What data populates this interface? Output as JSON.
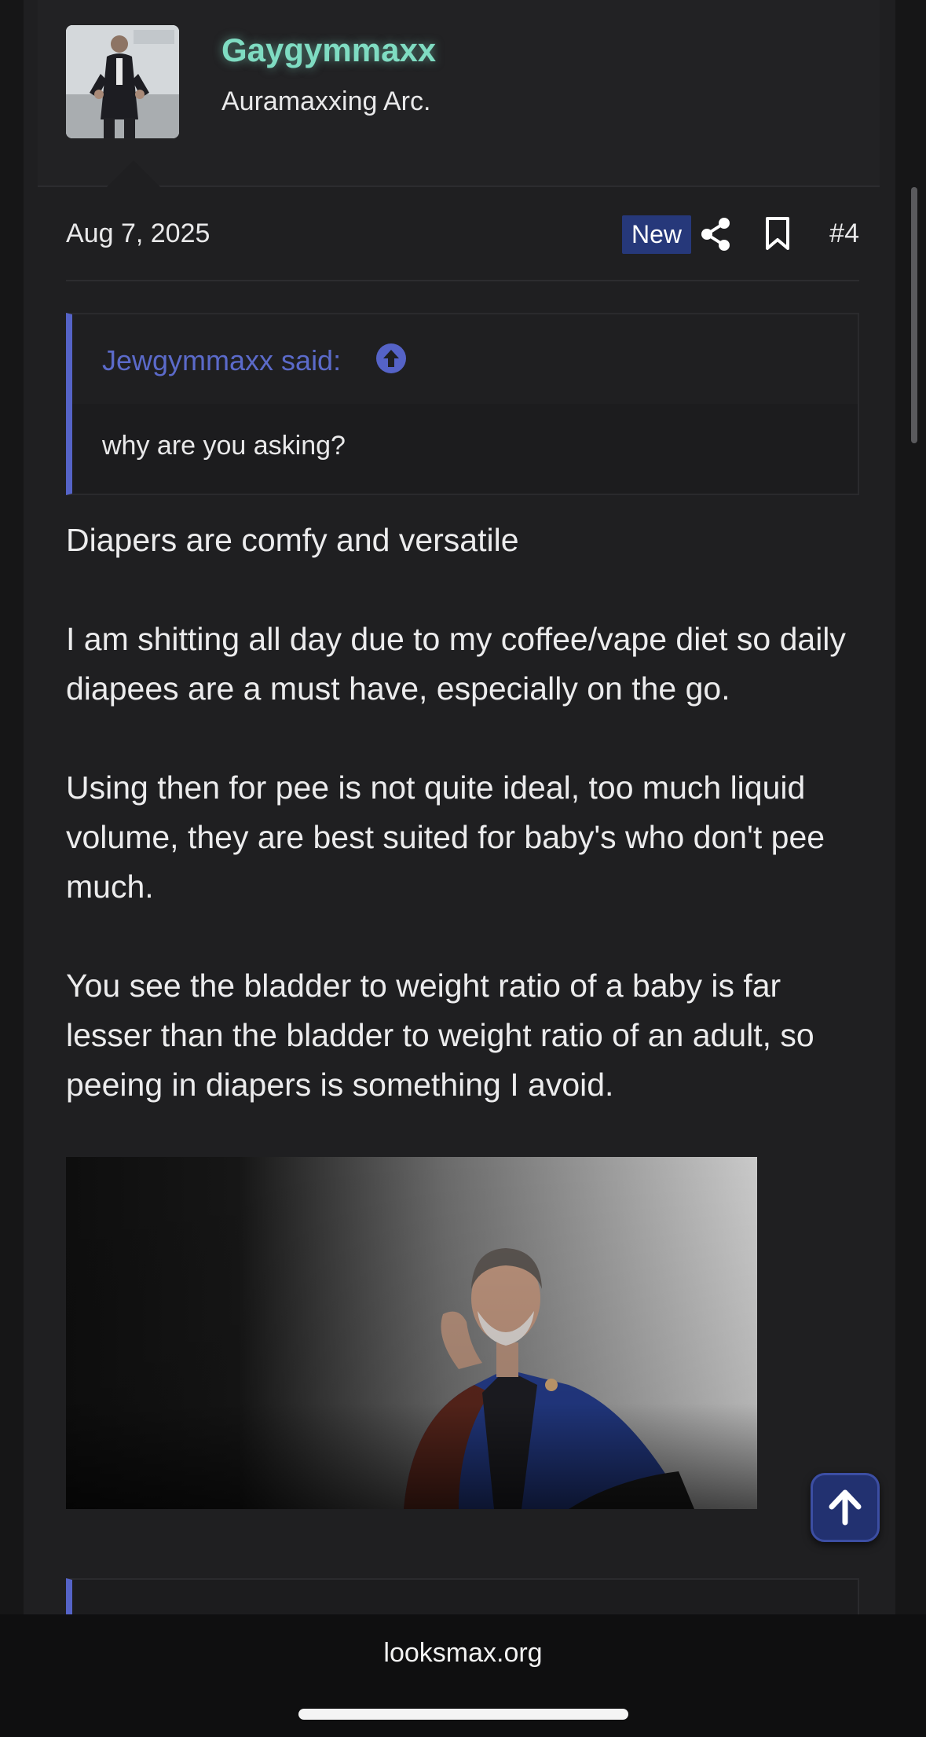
{
  "user": {
    "name": "Gaygymmaxx",
    "title": "Auramaxxing Arc."
  },
  "post": {
    "date": "Aug 7, 2025",
    "badge": "New",
    "number": "#4",
    "quote": {
      "author": "Jewgymmaxx said:",
      "text": "why are you asking?"
    },
    "paragraphs": [
      "Diapers are comfy and versatile",
      "I am shitting all day due to my coffee/vape diet so daily diapees are a must have, especially on the go.",
      "Using then for pee is not quite ideal, too much liquid volume, they are best suited for baby's who don't pee much.",
      "You see the bladder to weight ratio of a baby is far lesser than the bladder to weight ratio of an adult, so peeing in diapers is something I avoid."
    ]
  },
  "icons": {
    "share": "share-icon",
    "bookmark": "bookmark-icon",
    "quote_jump": "arrow-up-circle-icon",
    "scroll_top": "arrow-up-icon"
  },
  "colors": {
    "username": "#7fdcc2",
    "accent": "#5563c7",
    "badge_bg": "#26387a"
  },
  "browser": {
    "url": "looksmax.org"
  }
}
